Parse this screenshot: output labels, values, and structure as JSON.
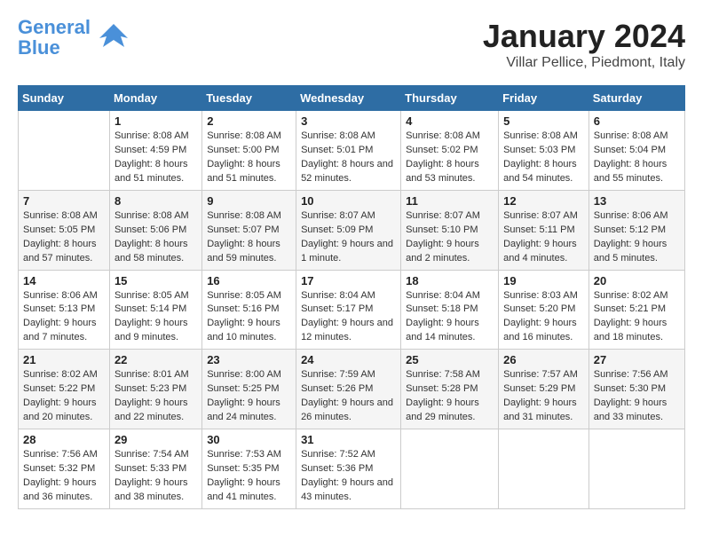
{
  "header": {
    "logo_general": "General",
    "logo_blue": "Blue",
    "title": "January 2024",
    "subtitle": "Villar Pellice, Piedmont, Italy"
  },
  "calendar": {
    "days_of_week": [
      "Sunday",
      "Monday",
      "Tuesday",
      "Wednesday",
      "Thursday",
      "Friday",
      "Saturday"
    ],
    "weeks": [
      [
        {
          "day": "",
          "sunrise": "",
          "sunset": "",
          "daylight": ""
        },
        {
          "day": "1",
          "sunrise": "Sunrise: 8:08 AM",
          "sunset": "Sunset: 4:59 PM",
          "daylight": "Daylight: 8 hours and 51 minutes."
        },
        {
          "day": "2",
          "sunrise": "Sunrise: 8:08 AM",
          "sunset": "Sunset: 5:00 PM",
          "daylight": "Daylight: 8 hours and 51 minutes."
        },
        {
          "day": "3",
          "sunrise": "Sunrise: 8:08 AM",
          "sunset": "Sunset: 5:01 PM",
          "daylight": "Daylight: 8 hours and 52 minutes."
        },
        {
          "day": "4",
          "sunrise": "Sunrise: 8:08 AM",
          "sunset": "Sunset: 5:02 PM",
          "daylight": "Daylight: 8 hours and 53 minutes."
        },
        {
          "day": "5",
          "sunrise": "Sunrise: 8:08 AM",
          "sunset": "Sunset: 5:03 PM",
          "daylight": "Daylight: 8 hours and 54 minutes."
        },
        {
          "day": "6",
          "sunrise": "Sunrise: 8:08 AM",
          "sunset": "Sunset: 5:04 PM",
          "daylight": "Daylight: 8 hours and 55 minutes."
        }
      ],
      [
        {
          "day": "7",
          "sunrise": "Sunrise: 8:08 AM",
          "sunset": "Sunset: 5:05 PM",
          "daylight": "Daylight: 8 hours and 57 minutes."
        },
        {
          "day": "8",
          "sunrise": "Sunrise: 8:08 AM",
          "sunset": "Sunset: 5:06 PM",
          "daylight": "Daylight: 8 hours and 58 minutes."
        },
        {
          "day": "9",
          "sunrise": "Sunrise: 8:08 AM",
          "sunset": "Sunset: 5:07 PM",
          "daylight": "Daylight: 8 hours and 59 minutes."
        },
        {
          "day": "10",
          "sunrise": "Sunrise: 8:07 AM",
          "sunset": "Sunset: 5:09 PM",
          "daylight": "Daylight: 9 hours and 1 minute."
        },
        {
          "day": "11",
          "sunrise": "Sunrise: 8:07 AM",
          "sunset": "Sunset: 5:10 PM",
          "daylight": "Daylight: 9 hours and 2 minutes."
        },
        {
          "day": "12",
          "sunrise": "Sunrise: 8:07 AM",
          "sunset": "Sunset: 5:11 PM",
          "daylight": "Daylight: 9 hours and 4 minutes."
        },
        {
          "day": "13",
          "sunrise": "Sunrise: 8:06 AM",
          "sunset": "Sunset: 5:12 PM",
          "daylight": "Daylight: 9 hours and 5 minutes."
        }
      ],
      [
        {
          "day": "14",
          "sunrise": "Sunrise: 8:06 AM",
          "sunset": "Sunset: 5:13 PM",
          "daylight": "Daylight: 9 hours and 7 minutes."
        },
        {
          "day": "15",
          "sunrise": "Sunrise: 8:05 AM",
          "sunset": "Sunset: 5:14 PM",
          "daylight": "Daylight: 9 hours and 9 minutes."
        },
        {
          "day": "16",
          "sunrise": "Sunrise: 8:05 AM",
          "sunset": "Sunset: 5:16 PM",
          "daylight": "Daylight: 9 hours and 10 minutes."
        },
        {
          "day": "17",
          "sunrise": "Sunrise: 8:04 AM",
          "sunset": "Sunset: 5:17 PM",
          "daylight": "Daylight: 9 hours and 12 minutes."
        },
        {
          "day": "18",
          "sunrise": "Sunrise: 8:04 AM",
          "sunset": "Sunset: 5:18 PM",
          "daylight": "Daylight: 9 hours and 14 minutes."
        },
        {
          "day": "19",
          "sunrise": "Sunrise: 8:03 AM",
          "sunset": "Sunset: 5:20 PM",
          "daylight": "Daylight: 9 hours and 16 minutes."
        },
        {
          "day": "20",
          "sunrise": "Sunrise: 8:02 AM",
          "sunset": "Sunset: 5:21 PM",
          "daylight": "Daylight: 9 hours and 18 minutes."
        }
      ],
      [
        {
          "day": "21",
          "sunrise": "Sunrise: 8:02 AM",
          "sunset": "Sunset: 5:22 PM",
          "daylight": "Daylight: 9 hours and 20 minutes."
        },
        {
          "day": "22",
          "sunrise": "Sunrise: 8:01 AM",
          "sunset": "Sunset: 5:23 PM",
          "daylight": "Daylight: 9 hours and 22 minutes."
        },
        {
          "day": "23",
          "sunrise": "Sunrise: 8:00 AM",
          "sunset": "Sunset: 5:25 PM",
          "daylight": "Daylight: 9 hours and 24 minutes."
        },
        {
          "day": "24",
          "sunrise": "Sunrise: 7:59 AM",
          "sunset": "Sunset: 5:26 PM",
          "daylight": "Daylight: 9 hours and 26 minutes."
        },
        {
          "day": "25",
          "sunrise": "Sunrise: 7:58 AM",
          "sunset": "Sunset: 5:28 PM",
          "daylight": "Daylight: 9 hours and 29 minutes."
        },
        {
          "day": "26",
          "sunrise": "Sunrise: 7:57 AM",
          "sunset": "Sunset: 5:29 PM",
          "daylight": "Daylight: 9 hours and 31 minutes."
        },
        {
          "day": "27",
          "sunrise": "Sunrise: 7:56 AM",
          "sunset": "Sunset: 5:30 PM",
          "daylight": "Daylight: 9 hours and 33 minutes."
        }
      ],
      [
        {
          "day": "28",
          "sunrise": "Sunrise: 7:56 AM",
          "sunset": "Sunset: 5:32 PM",
          "daylight": "Daylight: 9 hours and 36 minutes."
        },
        {
          "day": "29",
          "sunrise": "Sunrise: 7:54 AM",
          "sunset": "Sunset: 5:33 PM",
          "daylight": "Daylight: 9 hours and 38 minutes."
        },
        {
          "day": "30",
          "sunrise": "Sunrise: 7:53 AM",
          "sunset": "Sunset: 5:35 PM",
          "daylight": "Daylight: 9 hours and 41 minutes."
        },
        {
          "day": "31",
          "sunrise": "Sunrise: 7:52 AM",
          "sunset": "Sunset: 5:36 PM",
          "daylight": "Daylight: 9 hours and 43 minutes."
        },
        {
          "day": "",
          "sunrise": "",
          "sunset": "",
          "daylight": ""
        },
        {
          "day": "",
          "sunrise": "",
          "sunset": "",
          "daylight": ""
        },
        {
          "day": "",
          "sunrise": "",
          "sunset": "",
          "daylight": ""
        }
      ]
    ]
  }
}
